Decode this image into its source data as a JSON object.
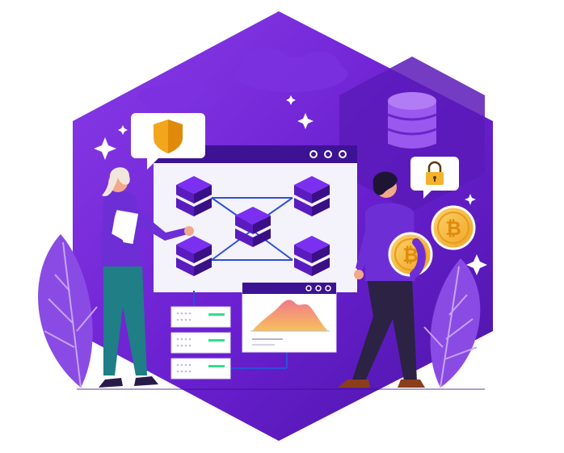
{
  "illustration": {
    "subject": "blockchain-network-isometric-hero",
    "colors": {
      "hexagon_dark": "#4a15a6",
      "hexagon_mid": "#6a1fd0",
      "hexagon_light": "#8a3ce8",
      "cube_top": "#7b2ff0",
      "cube_side": "#3a1087",
      "window_bg": "#f4f2fa",
      "window_bar": "#3d1395",
      "connector": "#2e4fd8",
      "shield": "#f3a51c",
      "coin": "#f6b93b",
      "coin_border": "#e89b1a",
      "server_led": "#2ee08a",
      "chart_fill_top": "#f07a8a",
      "chart_fill_bottom": "#f7c05c",
      "leaf": "#8a4be4",
      "woman_shirt": "#6d2ed6",
      "woman_pants": "#1f7e86",
      "woman_hair": "#f0e6dc",
      "man_shirt": "#6d2ed6",
      "man_pants": "#2b2244",
      "skin": "#f2a88a"
    },
    "icons": [
      "shield-icon",
      "padlock-icon",
      "bitcoin-icon",
      "database-icon",
      "sparkle-icon",
      "window-dot-icon"
    ]
  }
}
